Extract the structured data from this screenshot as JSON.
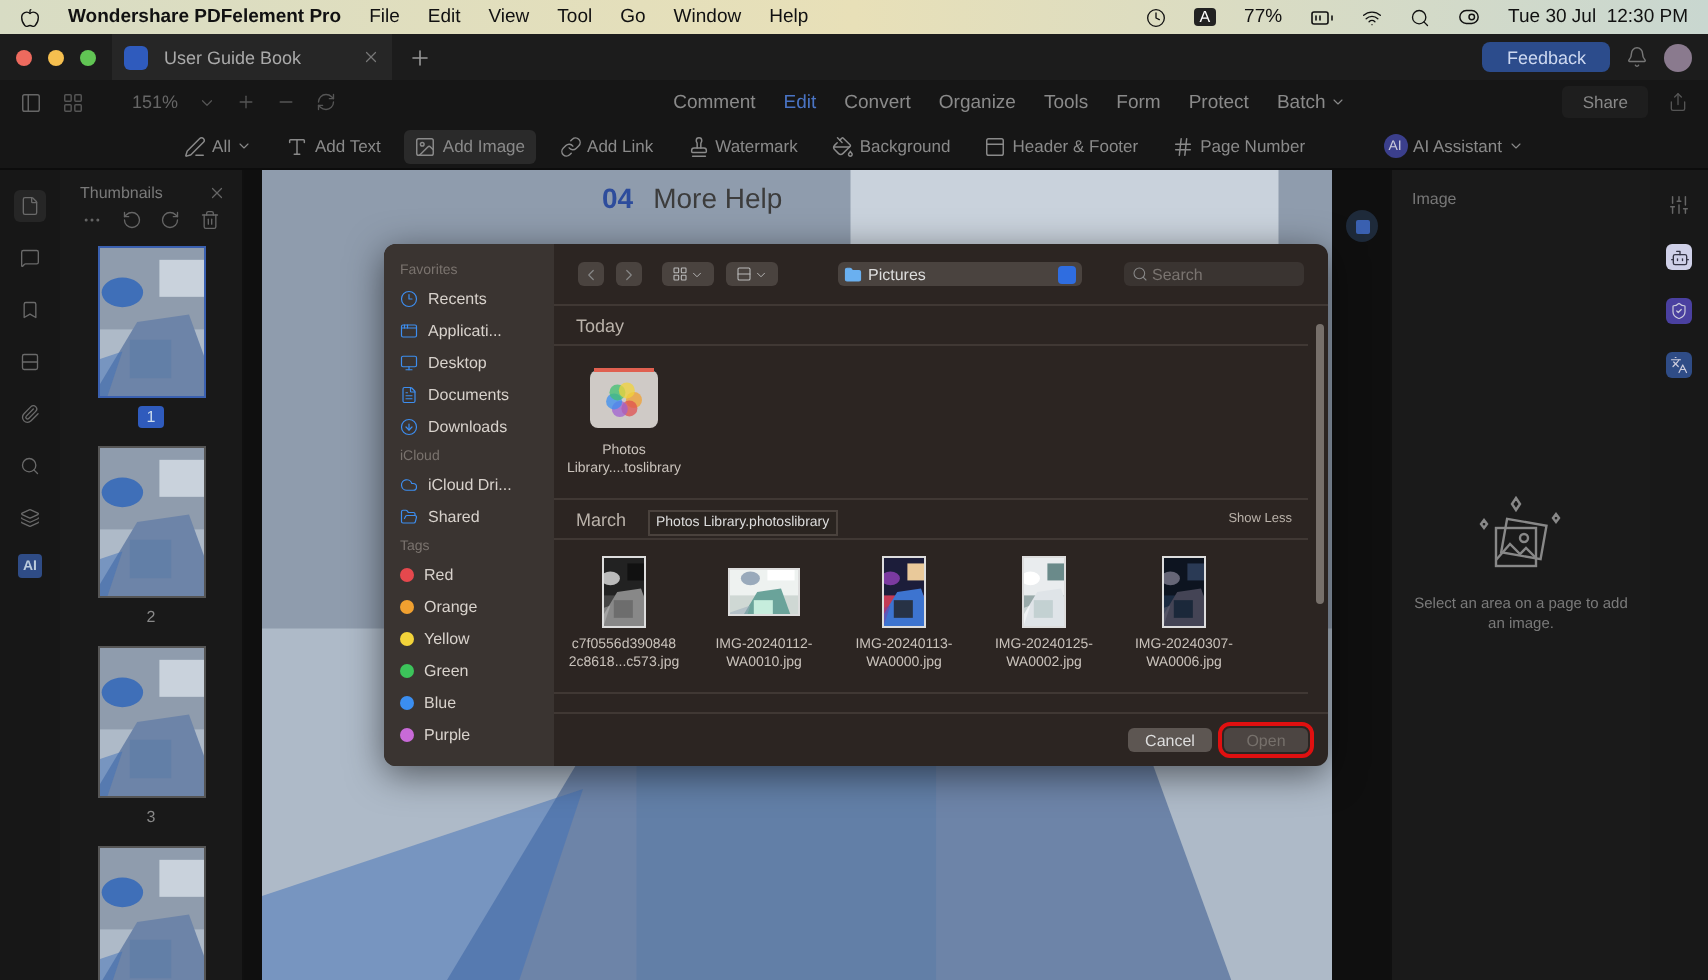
{
  "menubar": {
    "app": "Wondershare PDFelement Pro",
    "items": [
      "File",
      "Edit",
      "View",
      "Tool",
      "Go",
      "Window",
      "Help"
    ],
    "input_source": "A",
    "battery": "77%",
    "datetime": "Tue 30 Jul  12:30 PM"
  },
  "tabbar": {
    "tab": "User Guide Book",
    "feedback": "Feedback"
  },
  "toolbar": {
    "zoom": "151%",
    "menus": [
      {
        "label": "Comment",
        "selected": false
      },
      {
        "label": "Edit",
        "selected": true
      },
      {
        "label": "Convert",
        "selected": false
      },
      {
        "label": "Organize",
        "selected": false
      },
      {
        "label": "Tools",
        "selected": false
      },
      {
        "label": "Form",
        "selected": false
      },
      {
        "label": "Protect",
        "selected": false
      },
      {
        "label": "Batch",
        "selected": false,
        "dropdown": true
      }
    ],
    "share": "Share"
  },
  "edit_tools": {
    "filter": "All",
    "tools": [
      {
        "label": "Add Text",
        "selected": false
      },
      {
        "label": "Add Image",
        "selected": true
      },
      {
        "label": "Add Link",
        "selected": false
      },
      {
        "label": "Watermark",
        "selected": false
      },
      {
        "label": "Background",
        "selected": false
      },
      {
        "label": "Header & Footer",
        "selected": false
      },
      {
        "label": "Page Number",
        "selected": false
      }
    ],
    "ai_badge": "AI",
    "ai": "AI Assistant"
  },
  "rail": [
    {
      "selected": true
    },
    {
      "selected": false
    },
    {
      "selected": false
    },
    {
      "selected": false
    },
    {
      "selected": false
    },
    {
      "selected": false
    },
    {
      "selected": false
    },
    {
      "selected": false,
      "label": "AI"
    }
  ],
  "thumbnails": {
    "title": "Thumbnails",
    "pages": [
      {
        "label": "1",
        "selected": true
      },
      {
        "label": "2",
        "selected": false
      },
      {
        "label": "3",
        "selected": false
      },
      {
        "selected": false
      }
    ]
  },
  "document": {
    "number": "04",
    "heading": "More Help"
  },
  "dialog": {
    "sidebar": [
      {
        "title": "Favorites",
        "items": [
          {
            "label": "Recents"
          },
          {
            "label": "Applicati..."
          },
          {
            "label": "Desktop"
          },
          {
            "label": "Documents"
          },
          {
            "label": "Downloads"
          }
        ]
      },
      {
        "title": "iCloud",
        "items": [
          {
            "label": "iCloud Dri..."
          },
          {
            "label": "Shared"
          }
        ]
      },
      {
        "title": "Tags",
        "items": [
          {
            "label": "Red",
            "color": "#e5484d"
          },
          {
            "label": "Orange",
            "color": "#f0a030"
          },
          {
            "label": "Yellow",
            "color": "#f2d33a"
          },
          {
            "label": "Green",
            "color": "#3cc35a"
          },
          {
            "label": "Blue",
            "color": "#3b8ef0"
          },
          {
            "label": "Purple",
            "color": "#c86ad8"
          }
        ]
      }
    ],
    "location": "Pictures",
    "search": {
      "placeholder": "Search"
    },
    "sections": [
      {
        "title": "Today",
        "files": [
          {
            "name": "Photos Library....toslibrary",
            "kind": "library"
          }
        ]
      },
      {
        "title": "March",
        "action": "Show Less",
        "files": [
          {
            "name": "c7f0556d390848 2c8618...c573.jpg",
            "kind": "picture"
          },
          {
            "name": "IMG-20240112-WA0010.jpg",
            "kind": "picture"
          },
          {
            "name": "IMG-20240113-WA0000.jpg",
            "kind": "picture"
          },
          {
            "name": "IMG-20240125-WA0002.jpg",
            "kind": "picture"
          },
          {
            "name": "IMG-20240307-WA0006.jpg",
            "kind": "picture"
          }
        ]
      }
    ],
    "tooltip": "Photos Library.photoslibrary",
    "buttons": [
      {
        "label": "Cancel",
        "disabled": false,
        "highlighted": false
      },
      {
        "label": "Open",
        "disabled": true,
        "highlighted": true
      }
    ]
  },
  "right_panel": {
    "title": "Image",
    "message": "Select an area on a page to add an image."
  }
}
